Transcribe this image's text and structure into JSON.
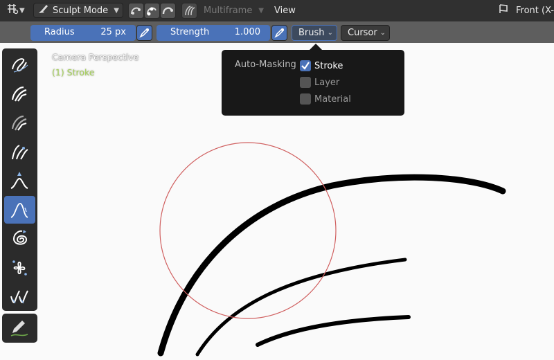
{
  "header": {
    "mode_label": "Sculpt Mode",
    "multiframe_label": "Multiframe",
    "view_menu_label": "View",
    "view_name": "Front (X-"
  },
  "tool_settings": {
    "radius_label": "Radius",
    "radius_value": "25 px",
    "strength_label": "Strength",
    "strength_value": "1.000",
    "brush_label": "Brush",
    "cursor_label": "Cursor"
  },
  "overlay": {
    "camera_text": "Camera Perspective",
    "object_text": "(1) Stroke"
  },
  "auto_masking": {
    "title": "Auto-Masking",
    "options": [
      {
        "label": "Stroke",
        "checked": true
      },
      {
        "label": "Layer",
        "checked": false
      },
      {
        "label": "Material",
        "checked": false
      }
    ]
  },
  "toolbar": {
    "tools": [
      {
        "icon": "smooth-brush-icon",
        "active": false
      },
      {
        "icon": "thickness-brush-icon",
        "active": false
      },
      {
        "icon": "strength-brush-icon",
        "active": false
      },
      {
        "icon": "randomize-brush-icon",
        "active": false
      },
      {
        "icon": "grab-brush-icon",
        "active": false
      },
      {
        "icon": "push-brush-icon",
        "active": true
      },
      {
        "icon": "twist-brush-icon",
        "active": false
      },
      {
        "icon": "pinch-brush-icon",
        "active": false
      },
      {
        "icon": "clone-brush-icon",
        "active": false
      }
    ],
    "annotate_icon": "annotate-pencil-icon"
  },
  "colors": {
    "accent": "#4a72b8",
    "object_text": "#a6d15a",
    "brush_circle": "#d06060"
  }
}
